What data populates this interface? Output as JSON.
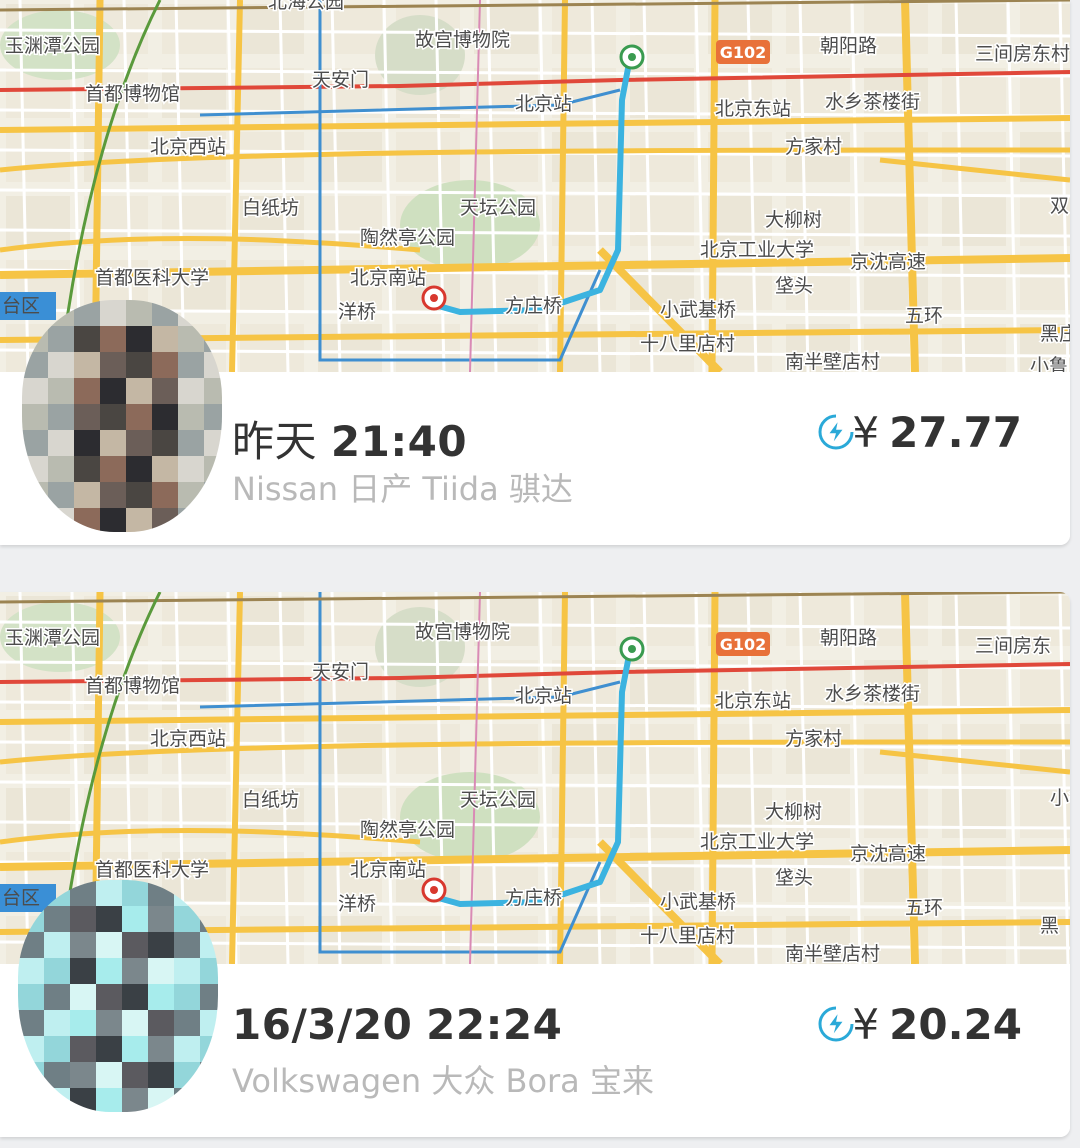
{
  "trips": [
    {
      "time_prefix": "昨天",
      "time_value": "21:40",
      "car": "Nissan 日产 Tiida 骐达",
      "currency": "¥",
      "price": "27.77",
      "avatar_colors": [
        "#d8d6cf",
        "#b9bbb0",
        "#9aa3a3"
      ],
      "map": {
        "road_badge": "G102",
        "labels": [
          "故宫博物院",
          "朝阳路",
          "三间房东村",
          "玉渊潭公园",
          "天安门",
          "首都博物馆",
          "北京站",
          "北京东站",
          "水乡茶楼街",
          "北京西站",
          "方家村",
          "白纸坊",
          "天坛公园",
          "大柳树",
          "陶然亭公园",
          "北京工业大学",
          "首都医科大学",
          "北京南站",
          "京沈高速",
          "洋桥",
          "方庄桥",
          "小武基桥",
          "垡头",
          "台区",
          "十八里店村",
          "南半壁店村",
          "五环",
          "黑庄",
          "双",
          "小鲁",
          "北海公园"
        ]
      }
    },
    {
      "time_prefix": "16/3/20",
      "time_value": "22:24",
      "car": "Volkswagen 大众 Bora 宝来",
      "currency": "¥",
      "price": "20.24",
      "avatar_colors": [
        "#bfeff0",
        "#93d6da",
        "#6f7f85"
      ],
      "map": {
        "road_badge": "G102",
        "labels": [
          "故宫博物院",
          "朝阳路",
          "三间房东",
          "玉渊潭公园",
          "天安门",
          "首都博物馆",
          "北京站",
          "北京东站",
          "水乡茶楼街",
          "北京西站",
          "方家村",
          "白纸坊",
          "天坛公园",
          "大柳树",
          "陶然亭公园",
          "北京工业大学",
          "首都医科大学",
          "北京南站",
          "京沈高速",
          "洋桥",
          "方庄桥",
          "小武基桥",
          "垡头",
          "台区",
          "十八里店村",
          "南半壁店村",
          "五环",
          "黑",
          "小鲁"
        ]
      }
    }
  ],
  "icons": {
    "surge": "lightning-bolt-icon",
    "start_pin": "green-start-pin-icon",
    "end_pin": "red-end-pin-icon"
  },
  "colors": {
    "route": "#3bb3e0",
    "highway": "#f6c445",
    "ring_road": "#f2b13c",
    "map_bg": "#f2efe4",
    "surge": "#2aa9d8",
    "red_line": "#e0483a"
  }
}
